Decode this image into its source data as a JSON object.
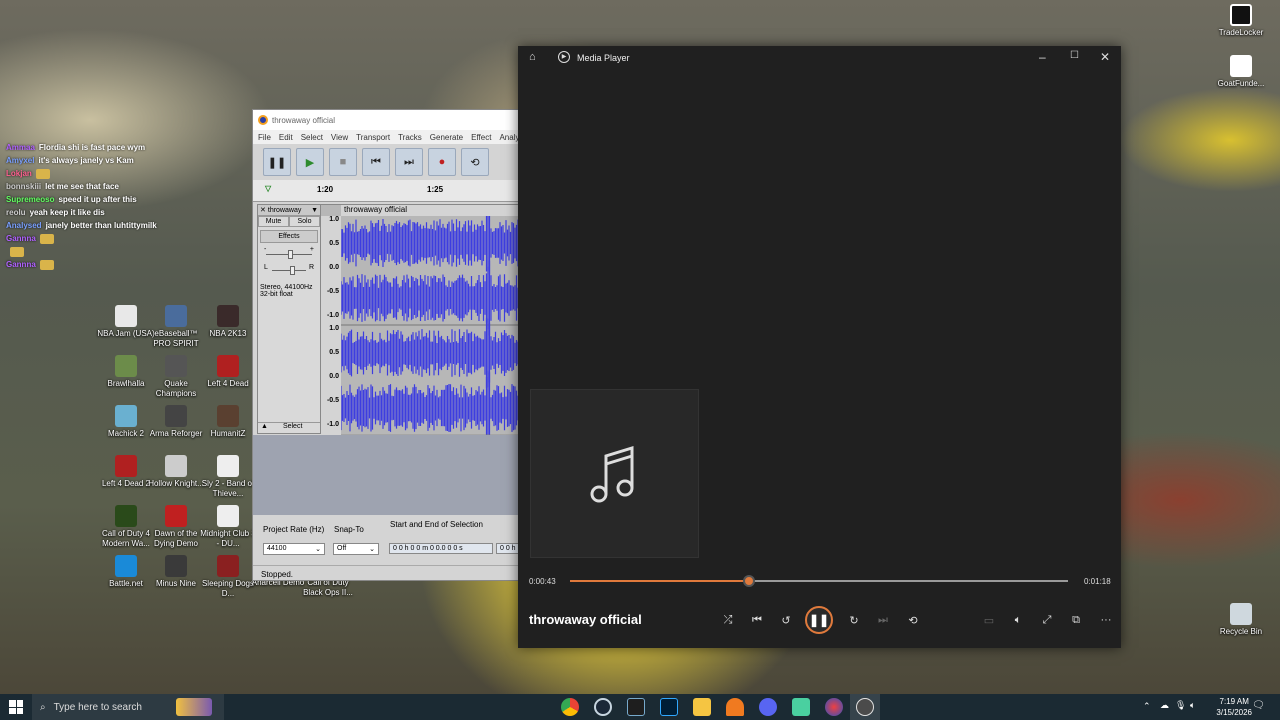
{
  "desktop": {
    "right_icons": [
      {
        "label": "TradeLocker",
        "name": "tradelocker-icon"
      },
      {
        "label": "GoatFunde...",
        "name": "goatfunded-icon"
      },
      {
        "label": "Recycle Bin",
        "name": "recycle-bin-icon"
      }
    ],
    "grid_icons": [
      {
        "label": "NBA Jam (USA)",
        "color": "#e8e8e8"
      },
      {
        "label": "eBaseball™ PRO SPIRIT",
        "color": "#4a6c9c"
      },
      {
        "label": "NBA 2K13",
        "color": "#3a2a2a"
      },
      {
        "label": "Brawlhalla",
        "color": "#6c8c4a"
      },
      {
        "label": "Quake Champions",
        "color": "#555555"
      },
      {
        "label": "Left 4 Dead",
        "color": "#b02020"
      },
      {
        "label": "Machick 2",
        "color": "#6ab0d0"
      },
      {
        "label": "Arma Reforger",
        "color": "#444444"
      },
      {
        "label": "HumanitZ",
        "color": "#5a4030"
      },
      {
        "label": "Left 4 Dead 2",
        "color": "#b02020"
      },
      {
        "label": "Hollow Knight...",
        "color": "#cccccc"
      },
      {
        "label": "Sly 2 - Band of Thieve...",
        "color": "#eeeeee"
      },
      {
        "label": "Call of Duty 4 Modern Wa...",
        "color": "#2a4a1a"
      },
      {
        "label": "Dawn of the Dying Demo",
        "color": "#c02020"
      },
      {
        "label": "Midnight Club 3 - DU...",
        "color": "#eeeeee"
      },
      {
        "label": "Battle.net",
        "color": "#1a8ad8"
      },
      {
        "label": "Minus Nine",
        "color": "#3a3a3a"
      },
      {
        "label": "Sleeping Dogs D...",
        "color": "#8a2020"
      }
    ],
    "hidden_labels": [
      "Anarcell Demo",
      "Call of Duty Black Ops II..."
    ]
  },
  "chat": [
    {
      "user": "Ammaa",
      "color": "#b060ff",
      "msg": "Flordia shi is fast pace wym"
    },
    {
      "user": "Amyxel",
      "color": "#7aa0ff",
      "msg": "it's always janely vs Kam"
    },
    {
      "user": "Lokjan",
      "color": "#ff6090",
      "msg": ""
    },
    {
      "user": "bonnskiii",
      "color": "#cccccc",
      "msg": "let me see that face"
    },
    {
      "user": "Supremeoso",
      "color": "#60ff60",
      "msg": "speed it up after this"
    },
    {
      "user": "reolu",
      "color": "#cccccc",
      "msg": "yeah keep it like dis"
    },
    {
      "user": "Analysed",
      "color": "#7aa0ff",
      "msg": "janely better than luhtittymilk"
    },
    {
      "user": "Gannna",
      "color": "#b060ff",
      "msg": ""
    },
    {
      "user": "",
      "color": "#b060ff",
      "msg": ""
    },
    {
      "user": "Gannna",
      "color": "#b060ff",
      "msg": ""
    }
  ],
  "audacity": {
    "title": "throwaway official",
    "menu": [
      "File",
      "Edit",
      "Select",
      "View",
      "Transport",
      "Tracks",
      "Generate",
      "Effect",
      "Analy"
    ],
    "ruler": [
      "1:20",
      "1:25"
    ],
    "track_name": "throwaway",
    "clip_name": "throwaway official",
    "mute": "Mute",
    "solo": "Solo",
    "effects": "Effects",
    "gain_minus": "-",
    "gain_plus": "+",
    "pan_l": "L",
    "pan_r": "R",
    "info1": "Stereo, 44100Hz",
    "info2": "32-bit float",
    "select": "Select",
    "scale": [
      "1.0",
      "0.5",
      "0.0",
      "-0.5",
      "-1.0"
    ],
    "project_rate_label": "Project Rate (Hz)",
    "snap_to_label": "Snap-To",
    "selection_label": "Start and End of Selection",
    "project_rate": "44100",
    "snap_to": "Off",
    "selection_value": "0 0 h 0 0 m 0 0.0 0 0 s",
    "selection_value2": "0 0 h",
    "status": "Stopped."
  },
  "media_player": {
    "title": "Media Player",
    "song": "throwaway official",
    "elapsed": "0:00:43",
    "total": "0:01:18",
    "progress": 0.36
  },
  "taskbar": {
    "search_placeholder": "Type here to search",
    "time": "7:19 AM",
    "date": "3/15/2026"
  }
}
